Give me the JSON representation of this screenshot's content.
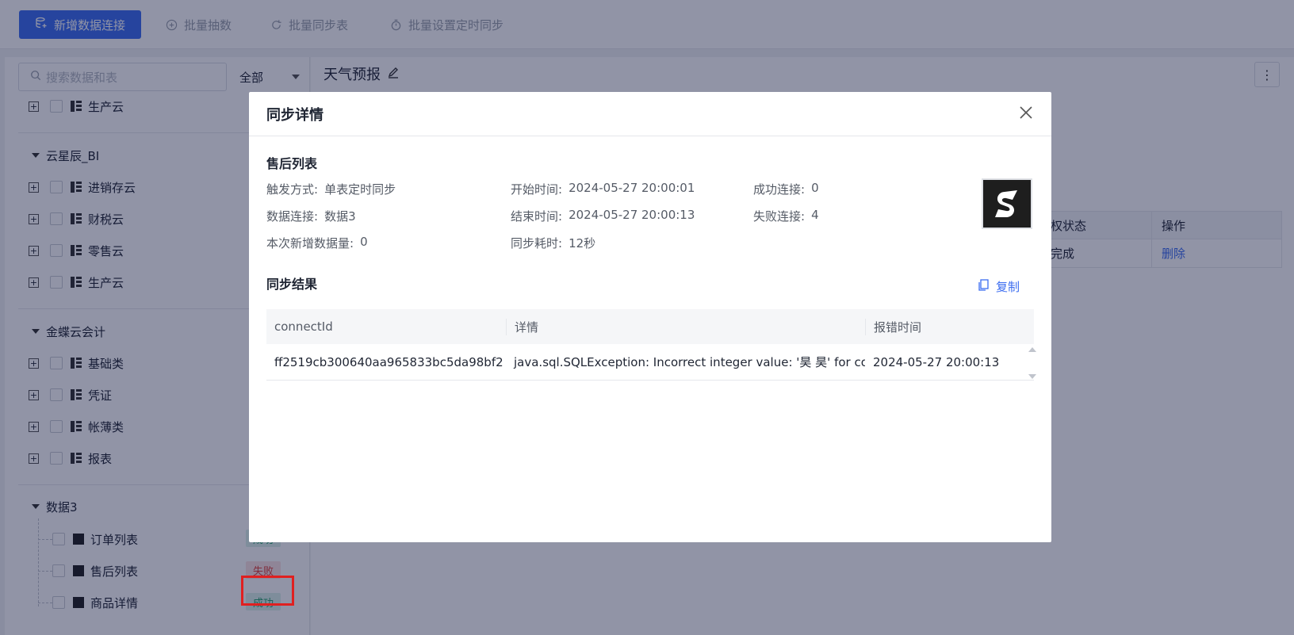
{
  "toolbar": {
    "new_connection": "新增数据连接",
    "batch_extract": "批量抽数",
    "batch_sync": "批量同步表",
    "batch_schedule": "批量设置定时同步"
  },
  "sidebar": {
    "search_placeholder": "搜索数据和表",
    "filter_value": "全部",
    "top_partial_item": "生产云",
    "groups": [
      {
        "name": "云星辰_BI",
        "items": [
          "进销存云",
          "财税云",
          "零售云",
          "生产云"
        ]
      },
      {
        "name": "金蝶云会计",
        "items": [
          "基础类",
          "凭证",
          "帐薄类",
          "报表"
        ]
      },
      {
        "name": "数据3",
        "tables": [
          {
            "name": "订单列表",
            "status": "成功"
          },
          {
            "name": "售后列表",
            "status": "失败"
          },
          {
            "name": "商品详情",
            "status": "成功"
          }
        ]
      }
    ]
  },
  "main": {
    "title": "天气预报",
    "table_headers": [
      "授权状态",
      "操作"
    ],
    "table_row": [
      "已完成",
      "删除"
    ]
  },
  "modal": {
    "title": "同步详情",
    "section_name": "售后列表",
    "trigger_label": "触发方式:",
    "trigger_value": "单表定时同步",
    "connection_label": "数据连接:",
    "connection_value": "数据3",
    "new_rows_label": "本次新增数据量:",
    "new_rows_value": "0",
    "start_label": "开始时间:",
    "start_value": "2024-05-27 20:00:01",
    "end_label": "结束时间:",
    "end_value": "2024-05-27 20:00:13",
    "duration_label": "同步耗时:",
    "duration_value": "12秒",
    "success_label": "成功连接:",
    "success_value": "0",
    "fail_label": "失败连接:",
    "fail_value": "4",
    "result_title": "同步结果",
    "copy_label": "复制",
    "columns": [
      "connectId",
      "详情",
      "报错时间"
    ],
    "rows": [
      [
        "ff2519cb300640aa965833bc5da98bf2",
        "java.sql.SQLException: Incorrect integer value: '昊 昊' for col...",
        "2024-05-27 20:00:13"
      ]
    ]
  },
  "colors": {
    "primary": "#3c6df0",
    "success": "#2ba471",
    "fail": "#e0443e",
    "highlight": "#e02020"
  }
}
